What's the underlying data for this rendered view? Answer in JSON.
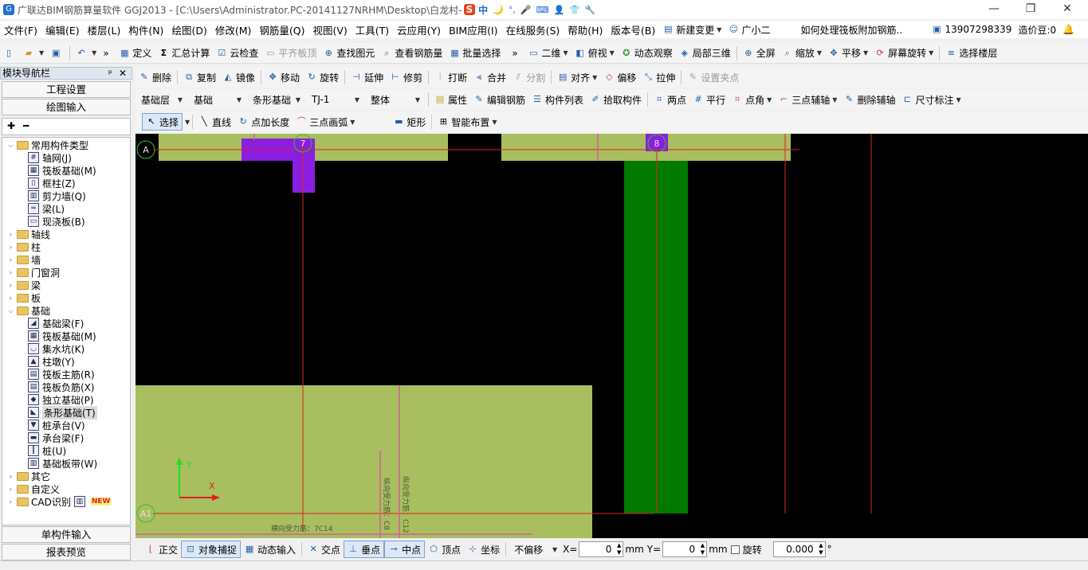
{
  "title": {
    "app": "广联达BIM钢筋算量软件 GGJ2013 - [C:\\Users\\Administrator.PC-20141127NRHM\\Desktop\\白龙村-"
  },
  "ime": {
    "items": [
      "中",
      "🌙",
      "°,",
      "🎤",
      "⌨",
      "👤",
      "👕",
      "🔧"
    ]
  },
  "menus": [
    "文件(F)",
    "编辑(E)",
    "楼层(L)",
    "构件(N)",
    "绘图(D)",
    "修改(M)",
    "钢筋量(Q)",
    "视图(V)",
    "工具(T)",
    "云应用(Y)",
    "BIM应用(I)",
    "在线服务(S)",
    "帮助(H)",
    "版本号(B)"
  ],
  "menu_extra": {
    "change": "新建变更",
    "assistant": "广小二",
    "question": "如何处理筏板附加钢筋..",
    "phone": "13907298339",
    "credits": "造价豆:0"
  },
  "toolbar1": {
    "items": [
      "定义",
      "汇总计算",
      "云检查",
      "平齐板顶",
      "查找图元",
      "查看钢筋量",
      "批量选择"
    ],
    "view": [
      "二维",
      "俯视",
      "动态观察",
      "局部三维",
      "全屏",
      "缩放",
      "平移",
      "屏幕旋转",
      "选择楼层"
    ]
  },
  "toolbar2": [
    "删除",
    "复制",
    "镜像",
    "移动",
    "旋转",
    "延伸",
    "修剪",
    "打断",
    "合并",
    "分割",
    "对齐",
    "偏移",
    "拉伸",
    "设置夹点"
  ],
  "toolbar3": {
    "layer": "基础层",
    "category": "基础",
    "type": "条形基础",
    "component": "TJ-1",
    "scope": "整体",
    "items": [
      "属性",
      "编辑钢筋",
      "构件列表",
      "拾取构件",
      "两点",
      "平行",
      "点角",
      "三点辅轴",
      "删除辅轴",
      "尺寸标注"
    ]
  },
  "toolbar4": [
    "选择",
    "直线",
    "点加长度",
    "三点画弧",
    "矩形",
    "智能布置"
  ],
  "nav": {
    "header": "模块导航栏",
    "tabs": [
      "工程设置",
      "绘图输入"
    ],
    "bottom_tabs": [
      "单构件输入",
      "报表预览"
    ]
  },
  "tree": [
    {
      "label": "常用构件类型",
      "level": 0,
      "kind": "folder",
      "expanded": true
    },
    {
      "label": "轴网(J)",
      "level": 1,
      "kind": "item",
      "icon": "#"
    },
    {
      "label": "筏板基础(M)",
      "level": 1,
      "kind": "item",
      "icon": "▦"
    },
    {
      "label": "框柱(Z)",
      "level": 1,
      "kind": "item",
      "icon": "▯"
    },
    {
      "label": "剪力墙(Q)",
      "level": 1,
      "kind": "item",
      "icon": "▥"
    },
    {
      "label": "梁(L)",
      "level": 1,
      "kind": "item",
      "icon": "═"
    },
    {
      "label": "现浇板(B)",
      "level": 1,
      "kind": "item",
      "icon": "▭"
    },
    {
      "label": "轴线",
      "level": 0,
      "kind": "folder"
    },
    {
      "label": "柱",
      "level": 0,
      "kind": "folder"
    },
    {
      "label": "墙",
      "level": 0,
      "kind": "folder"
    },
    {
      "label": "门窗洞",
      "level": 0,
      "kind": "folder"
    },
    {
      "label": "梁",
      "level": 0,
      "kind": "folder"
    },
    {
      "label": "板",
      "level": 0,
      "kind": "folder"
    },
    {
      "label": "基础",
      "level": 0,
      "kind": "folder",
      "expanded": true
    },
    {
      "label": "基础梁(F)",
      "level": 1,
      "kind": "item",
      "icon": "◢"
    },
    {
      "label": "筏板基础(M)",
      "level": 1,
      "kind": "item",
      "icon": "▦"
    },
    {
      "label": "集水坑(K)",
      "level": 1,
      "kind": "item",
      "icon": "◡"
    },
    {
      "label": "柱墩(Y)",
      "level": 1,
      "kind": "item",
      "icon": "▲"
    },
    {
      "label": "筏板主筋(R)",
      "level": 1,
      "kind": "item",
      "icon": "▤"
    },
    {
      "label": "筏板负筋(X)",
      "level": 1,
      "kind": "item",
      "icon": "▤"
    },
    {
      "label": "独立基础(P)",
      "level": 1,
      "kind": "item",
      "icon": "◆"
    },
    {
      "label": "条形基础(T)",
      "level": 1,
      "kind": "item",
      "icon": "◣",
      "selected": true
    },
    {
      "label": "桩承台(V)",
      "level": 1,
      "kind": "item",
      "icon": "▼"
    },
    {
      "label": "承台梁(F)",
      "level": 1,
      "kind": "item",
      "icon": "▬"
    },
    {
      "label": "桩(U)",
      "level": 1,
      "kind": "item",
      "icon": "┃"
    },
    {
      "label": "基础板带(W)",
      "level": 1,
      "kind": "item",
      "icon": "▥"
    },
    {
      "label": "其它",
      "level": 0,
      "kind": "folder"
    },
    {
      "label": "自定义",
      "level": 0,
      "kind": "folder"
    },
    {
      "label": "CAD识别",
      "level": 0,
      "kind": "folder",
      "badge": "NEW"
    }
  ],
  "canvas": {
    "axis_labels": [
      "A",
      "A1",
      "7",
      "8"
    ],
    "rebar_labels": [
      "横向受力筋：7C14",
      "纵向受力筋：C8",
      "纵向受力筋：C12"
    ],
    "ucs": {
      "x": "X",
      "y": "Y"
    }
  },
  "statusbar": {
    "items": [
      "正交",
      "对象捕捉",
      "动态输入",
      "交点",
      "垂点",
      "中点",
      "顶点",
      "坐标"
    ],
    "offset": "不偏移",
    "x_label": "X=",
    "x_value": "0",
    "unit1": "mm",
    "y_label": "Y=",
    "y_value": "0",
    "unit2": "mm",
    "rotate_label": "旋转",
    "rotate_value": "0.000",
    "degree": "°"
  },
  "colors": {
    "foundation": "#a9be5f",
    "column": "#8a1ee0",
    "beam": "#007a00",
    "axis_line": "#e02020",
    "rebar": "#d0609a"
  }
}
